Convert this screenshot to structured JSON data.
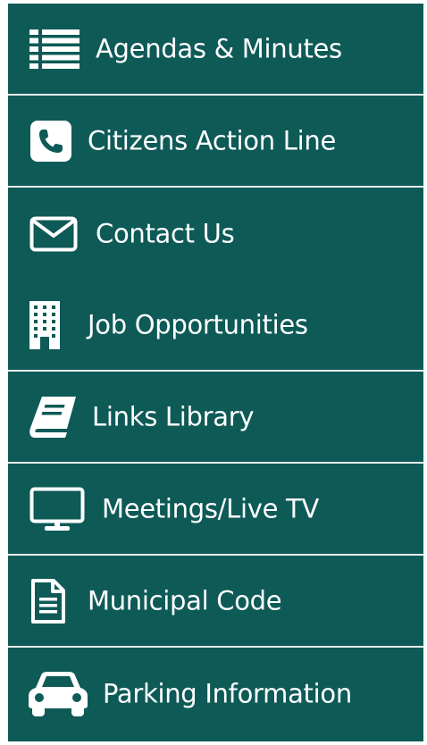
{
  "menu": {
    "items": [
      {
        "label": "Agendas & Minutes",
        "icon": "list-icon"
      },
      {
        "label": "Citizens Action Line",
        "icon": "phone-icon"
      },
      {
        "label": "Contact Us",
        "icon": "envelope-icon"
      },
      {
        "label": "Job Opportunities",
        "icon": "building-icon"
      },
      {
        "label": "Links Library",
        "icon": "book-icon"
      },
      {
        "label": "Meetings/Live TV",
        "icon": "monitor-icon"
      },
      {
        "label": "Municipal Code",
        "icon": "document-icon"
      },
      {
        "label": "Parking Information",
        "icon": "car-icon"
      }
    ]
  },
  "colors": {
    "background": "#0e5a57",
    "text": "#ffffff",
    "divider": "#e8eeee"
  }
}
